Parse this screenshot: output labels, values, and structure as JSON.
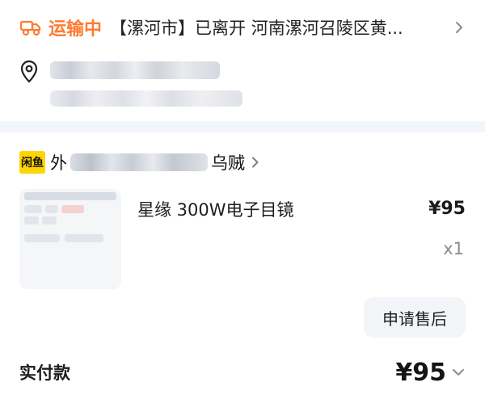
{
  "shipping": {
    "status": "运输中",
    "detail": "【漯河市】已离开 河南漯河召陵区黄..."
  },
  "address": {
    "line_1": "",
    "line_2": ""
  },
  "store": {
    "badge": "闲鱼",
    "name_prefix": "外",
    "name_suffix": "乌贼"
  },
  "product": {
    "title": "星缘 300W电子目镜",
    "price": "¥95",
    "quantity": "x1"
  },
  "actions": {
    "after_sale": "申请售后"
  },
  "payment": {
    "label": "实付款",
    "amount": "¥95"
  },
  "colors": {
    "status_orange": "#ff7a2f",
    "badge_yellow": "#ffd400",
    "button_bg": "#f3f5f8"
  },
  "icons": {
    "shipping": "truck-icon",
    "status_more": "chevron-right-icon",
    "address": "location-pin-icon",
    "store_more": "chevron-right-icon",
    "payment_more": "chevron-down-icon"
  }
}
